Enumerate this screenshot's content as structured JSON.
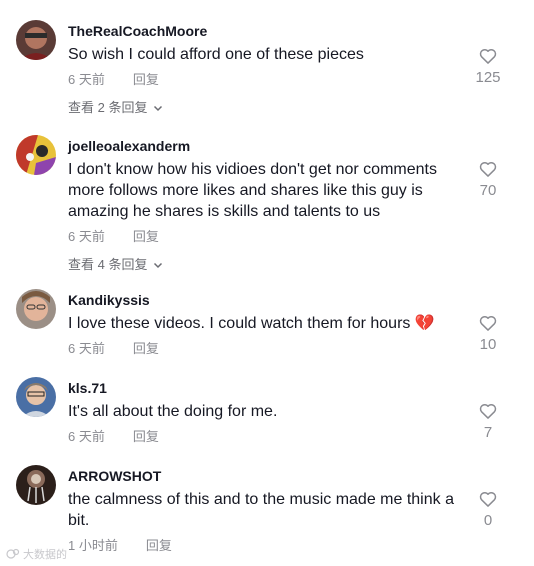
{
  "comments": [
    {
      "username": "TheRealCoachMoore",
      "text": "So wish I could afford one of these pieces",
      "time": "6 天前",
      "reply_label": "回复",
      "likes": "125",
      "view_replies": "查看 2 条回复"
    },
    {
      "username": "joelleoalexanderm",
      "text": "I don't know how his vidioes don't get nor comments more follows more likes and shares like this guy is amazing he shares is skills and talents to us",
      "time": "6 天前",
      "reply_label": "回复",
      "likes": "70",
      "view_replies": "查看 4 条回复"
    },
    {
      "username": "Kandikyssis",
      "text": "I love these videos. I could watch them for hours",
      "emoji": "💔",
      "time": "6 天前",
      "reply_label": "回复",
      "likes": "10"
    },
    {
      "username": "kls.71",
      "text": "It's all about the doing for me.",
      "time": "6 天前",
      "reply_label": "回复",
      "likes": "7"
    },
    {
      "username": "ARROWSHOT",
      "text": "the calmness of this and to the music made me think a bit.",
      "time": "1 小时前",
      "reply_label": "回复",
      "likes": "0"
    }
  ],
  "watermark": "大数据的",
  "colors": {
    "meta_gray": "#8a8b91",
    "text": "#161823"
  },
  "icons": {
    "like": "heart-outline-icon",
    "expand": "chevron-down-icon"
  }
}
